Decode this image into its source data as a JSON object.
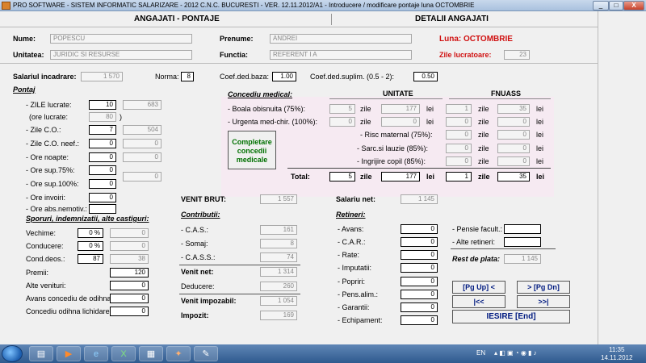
{
  "window": {
    "title": "PRO SOFTWARE - SISTEM INFORMATIC SALARIZARE - 2012 C.N.C. BUCURESTI - VER. 12.11.2012/A1 - Introducere / modificare pontaje luna OCTOMBRIE",
    "minimize": "_",
    "maximize": "□",
    "close": "X"
  },
  "header": {
    "left": "ANGAJATI - PONTAJE",
    "right": "DETALII ANGAJATI"
  },
  "employee": {
    "nume_label": "Nume:",
    "nume": "POPESCU",
    "prenume_label": "Prenume:",
    "prenume": "ANDREI",
    "unitatea_label": "Unitatea:",
    "unitatea": "JURIDIC SI RESURSE",
    "functia_label": "Functia:",
    "functia": "REFERENT I A",
    "luna": "Luna: OCTOMBRIE",
    "zile_lucratoare_label": "Zile lucratoare:",
    "zile_lucratoare": "23"
  },
  "salary": {
    "salariul_label": "Salariul incadrare:",
    "salariul": "1 570",
    "norma_label": "Norma:",
    "norma": "8",
    "coef_baza_label": "Coef.ded.baza:",
    "coef_baza": "1.00",
    "coef_supl_label": "Coef.ded.suplim. (0.5 - 2):",
    "coef_supl": "0.50"
  },
  "pontaj": {
    "title": "Pontaj",
    "zile_lucrate_label": "- ZILE lucrate:",
    "zile_lucrate": "10",
    "zile_lucrate_val": "683",
    "ore_lucrate_label": "(ore lucrate:",
    "ore_lucrate": "80",
    "ore_lucrate_close": ")",
    "zile_co_label": "- Zile C.O.:",
    "zile_co": "7",
    "zile_co_val": "504",
    "zile_co_neef_label": "- Zile C.O. neef.:",
    "zile_co_neef": "0",
    "zile_co_neef_val": "0",
    "ore_noapte_label": "- Ore noapte:",
    "ore_noapte": "0",
    "ore_noapte_val": "0",
    "ore_sup75_label": "- Ore sup.75%:",
    "ore_sup75": "0",
    "ore_sup100_label": "- Ore sup.100%:",
    "ore_sup100": "0",
    "ore_sup_val": "0",
    "ore_invoiri_label": "- Ore invoiri:",
    "ore_invoiri": "0",
    "ore_abs_label": "- Ore abs.nemotiv.:",
    "ore_abs": ""
  },
  "sporuri": {
    "title": "Sporuri, indemnizatii, alte castiguri:",
    "vechime_label": "Vechime:",
    "vechime_pct": "0 %",
    "vechime_val": "0",
    "conducere_label": "Conducere:",
    "conducere_pct": "0 %",
    "conducere_val": "0",
    "cond_deos_label": "Cond.deos.:",
    "cond_deos_pct": "87",
    "cond_deos_val": "38",
    "premii_label": "Premii:",
    "premii": "120",
    "alte_venituri_label": "Alte venituri:",
    "alte_venituri": "0",
    "avans_co_label": "Avans concediu de odihna:",
    "avans_co": "0",
    "co_lichidare_label": "Concediu odihna lichidare:",
    "co_lichidare": "0"
  },
  "medical": {
    "title": "Concediu medical:",
    "unitate": "UNITATE",
    "fnuass": "FNUASS",
    "zile": "zile",
    "lei": "lei",
    "rows": [
      {
        "label": "- Boala obisnuita (75%):",
        "u_zile": "5",
        "u_lei": "177",
        "f_zile": "1",
        "f_lei": "35"
      },
      {
        "label": "- Urgenta med-chir. (100%):",
        "u_zile": "0",
        "u_lei": "0",
        "f_zile": "0",
        "f_lei": "0"
      },
      {
        "label": "- Risc maternal (75%):",
        "f_zile": "0",
        "f_lei": "0"
      },
      {
        "label": "- Sarc.si lauzie (85%):",
        "f_zile": "0",
        "f_lei": "0"
      },
      {
        "label": "- Ingrijire copil (85%):",
        "f_zile": "0",
        "f_lei": "0"
      }
    ],
    "completare": "Completare concedii medicale",
    "total_label": "Total:",
    "total_u_zile": "5",
    "total_u_lei": "177",
    "total_f_zile": "1",
    "total_f_lei": "35"
  },
  "contributii": {
    "venit_brut_label": "VENIT BRUT:",
    "venit_brut": "1 557",
    "title": "Contributii:",
    "cas_label": "- C.A.S.:",
    "cas": "161",
    "somaj_label": "- Somaj:",
    "somaj": "8",
    "cass_label": "- C.A.S.S.:",
    "cass": "74",
    "venit_net_label": "Venit net:",
    "venit_net": "1 314",
    "deducere_label": "Deducere:",
    "deducere": "260",
    "venit_impozabil_label": "Venit impozabil:",
    "venit_impozabil": "1 054",
    "impozit_label": "Impozit:",
    "impozit": "169"
  },
  "retineri": {
    "salariu_net_label": "Salariu net:",
    "salariu_net": "1 145",
    "title": "Retineri:",
    "avans_label": "- Avans:",
    "avans": "0",
    "car_label": "- C.A.R.:",
    "car": "0",
    "rate_label": "- Rate:",
    "rate": "0",
    "imputatii_label": "- Imputatii:",
    "imputatii": "0",
    "popriri_label": "- Popriri:",
    "popriri": "0",
    "pens_alim_label": "- Pens.alim.:",
    "pens_alim": "0",
    "garantii_label": "- Garantii:",
    "garantii": "0",
    "echipament_label": "- Echipament:",
    "echipament": "0",
    "pensie_label": "- Pensie facult.:",
    "pensie": "",
    "alte_retineri_label": "- Alte retineri:",
    "alte_retineri": "",
    "rest_label": "Rest de plata:",
    "rest": "1 145"
  },
  "nav": {
    "pgup": "[Pg Up] <",
    "pgdn": "> [Pg Dn]",
    "first": "|<<",
    "last": ">>|",
    "iesire": "IESIRE  [End]"
  },
  "taskbar": {
    "lang": "EN",
    "time": "11:35",
    "date": "14.11.2012"
  },
  "colors": {
    "red": "#d01010",
    "pink_panel": "#f6eaf2",
    "button_text": "#001a80",
    "green_text": "#007000"
  }
}
